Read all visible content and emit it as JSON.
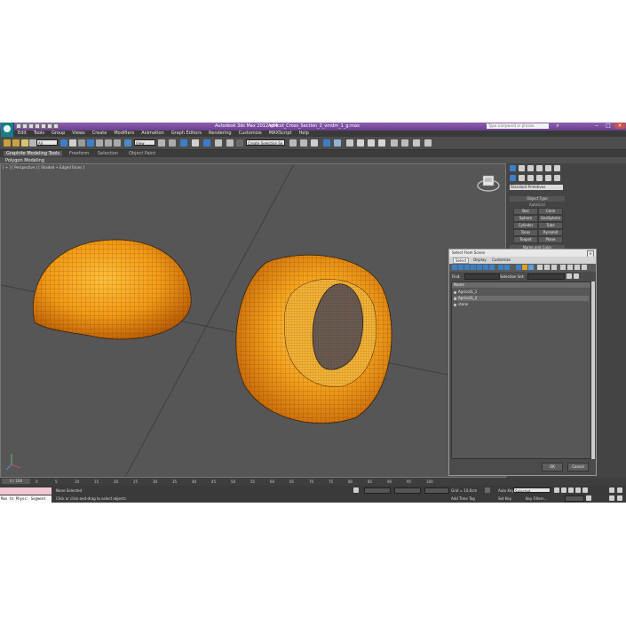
{
  "title": {
    "app": "Autodesk 3ds Max 2012 x64",
    "file": "Apricot_Cross_Section_2_vmdm_1_g.max",
    "search_placeholder": "Type a keyword or phrase"
  },
  "menu": [
    "Edit",
    "Tools",
    "Group",
    "Views",
    "Create",
    "Modifiers",
    "Animation",
    "Graph Editors",
    "Rendering",
    "Customize",
    "MAXScript",
    "Help"
  ],
  "toolbar": {
    "filter_value": "All",
    "view_value": "View",
    "selection_set_value": "Create Selection Se"
  },
  "ribbon": {
    "tabs": [
      "Graphite Modeling Tools",
      "Freeform",
      "Selection",
      "Object Paint"
    ],
    "panel": "Polygon Modeling"
  },
  "viewport": {
    "label": "[ + ] [ Perspective ] [ Shaded + Edged Faces ]"
  },
  "command_panel": {
    "category": "Standard Primitives",
    "object_type_title": "Object Type",
    "autogrid": "AutoGrid",
    "primitives": [
      "Box",
      "Cone",
      "Sphere",
      "GeoSphere",
      "Cylinder",
      "Tube",
      "Torus",
      "Pyramid",
      "Teapot",
      "Plane"
    ],
    "name_color_title": "Name and Color"
  },
  "dialog": {
    "title": "Select From Scene",
    "tabs": [
      "Select",
      "Display",
      "Customize"
    ],
    "find_label": "Find:",
    "selection_set_label": "Selection Set:",
    "column_header": "Name",
    "items": [
      "Apricot1_1",
      "Apricot1_2",
      "stone"
    ],
    "ok": "OK",
    "cancel": "Cancel"
  },
  "timeline": {
    "frame_counter": "0 / 100",
    "ticks": [
      "0",
      "5",
      "10",
      "15",
      "20",
      "25",
      "30",
      "35",
      "40",
      "45",
      "50",
      "55",
      "60",
      "65",
      "70",
      "75",
      "80",
      "85",
      "90",
      "95",
      "100"
    ]
  },
  "status": {
    "maxscript": "Max to Physc: Segment",
    "selected": "None Selected",
    "prompt": "Click or click-and-drag to select objects",
    "grid": "Grid = 10,0cm",
    "add_time_tag": "Add Time Tag",
    "auto_key": "Auto Key",
    "auto_key_value": "Selected",
    "set_key": "Set Key",
    "key_filters": "Key Filters..."
  },
  "colors": {
    "apricot_orange": "#f29a16",
    "viewport_bg": "#565656",
    "title_purple": "#7a4a9e"
  }
}
